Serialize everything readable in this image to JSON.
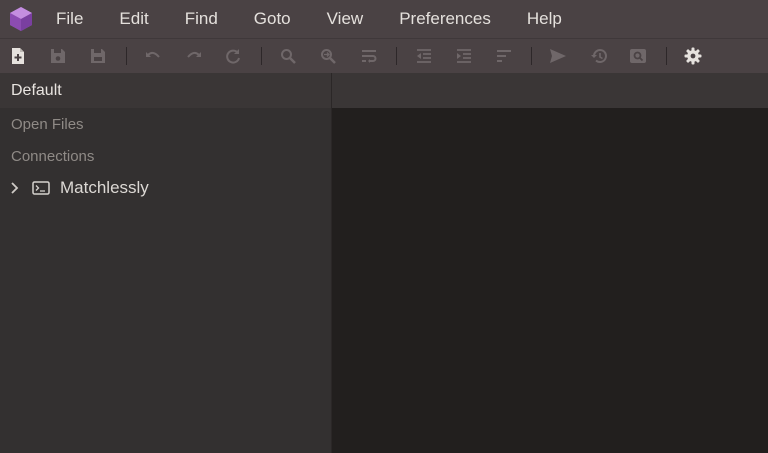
{
  "app": {
    "accent_color": "#8e55b0"
  },
  "menu": {
    "items": [
      {
        "label": "File"
      },
      {
        "label": "Edit"
      },
      {
        "label": "Find"
      },
      {
        "label": "Goto"
      },
      {
        "label": "View"
      },
      {
        "label": "Preferences"
      },
      {
        "label": "Help"
      }
    ]
  },
  "toolbar": {
    "icons": [
      {
        "name": "new-file-icon",
        "enabled": true
      },
      {
        "name": "save-icon",
        "enabled": false
      },
      {
        "name": "save-as-icon",
        "enabled": false
      },
      {
        "name": "undo-icon",
        "enabled": false
      },
      {
        "name": "redo-icon",
        "enabled": false
      },
      {
        "name": "refresh-icon",
        "enabled": false
      },
      {
        "name": "search-icon",
        "enabled": false
      },
      {
        "name": "search-replace-icon",
        "enabled": false
      },
      {
        "name": "word-wrap-icon",
        "enabled": false
      },
      {
        "name": "outdent-icon",
        "enabled": false
      },
      {
        "name": "indent-icon",
        "enabled": false
      },
      {
        "name": "sort-icon",
        "enabled": false
      },
      {
        "name": "send-icon",
        "enabled": false
      },
      {
        "name": "history-icon",
        "enabled": false
      },
      {
        "name": "preview-icon",
        "enabled": false
      },
      {
        "name": "gear-icon",
        "enabled": true
      }
    ]
  },
  "sidebar": {
    "header": "Default",
    "sections": {
      "open_files": "Open Files",
      "connections": "Connections"
    },
    "tree": [
      {
        "label": "Matchlessly",
        "icon": "terminal-icon",
        "expanded": false
      }
    ]
  }
}
